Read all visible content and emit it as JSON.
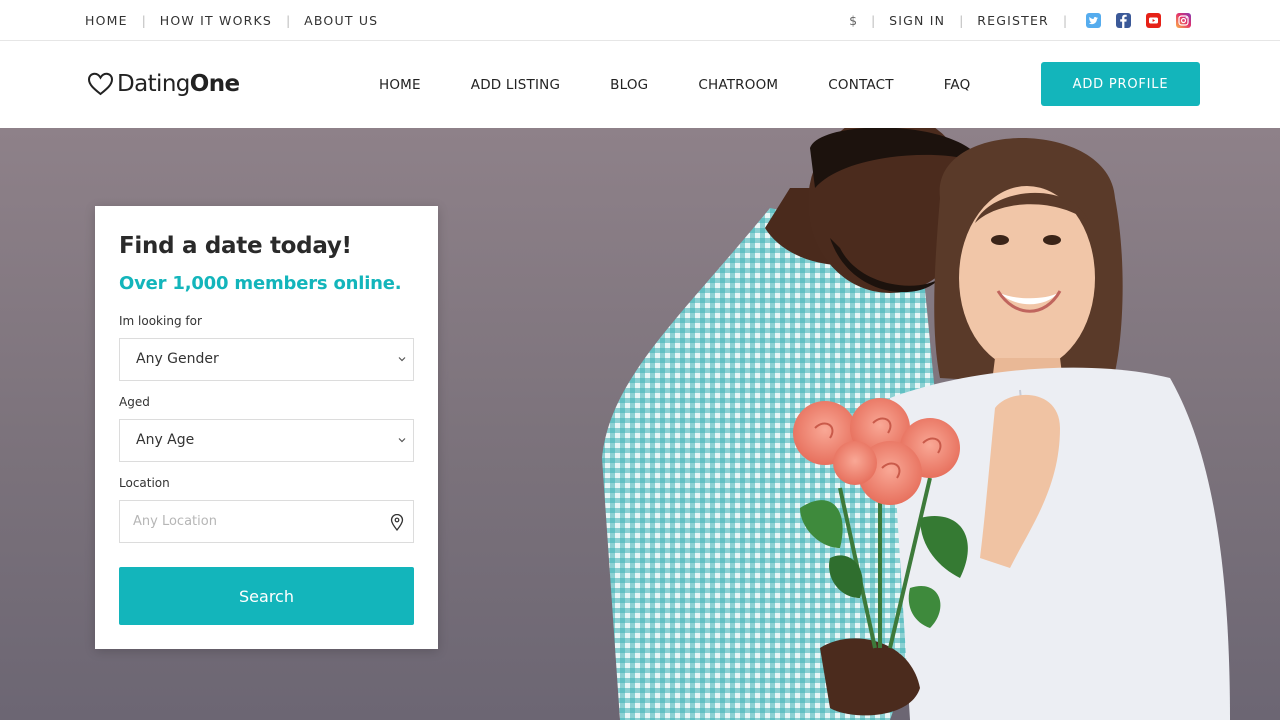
{
  "topbar": {
    "left_links": [
      "HOME",
      "HOW IT WORKS",
      "ABOUT US"
    ],
    "currency": "$",
    "sign_in": "SIGN IN",
    "register": "REGISTER",
    "social": [
      "twitter-icon",
      "facebook-icon",
      "youtube-icon",
      "instagram-icon"
    ]
  },
  "nav": {
    "logo_prefix": "Dating",
    "logo_bold": "One",
    "items": [
      "HOME",
      "ADD LISTING",
      "BLOG",
      "CHATROOM",
      "CONTACT",
      "FAQ"
    ],
    "cta": "ADD PROFILE"
  },
  "search_card": {
    "title": "Find a date today!",
    "subtitle": "Over 1,000 members online.",
    "looking_for_label": "Im looking for",
    "gender_value": "Any Gender",
    "aged_label": "Aged",
    "age_value": "Any Age",
    "location_label": "Location",
    "location_placeholder": "Any Location",
    "search_button": "Search"
  },
  "colors": {
    "accent": "#13b5bb",
    "hero_bg": "#857b83",
    "twitter": "#55acee",
    "facebook": "#3b5998",
    "youtube": "#e62117",
    "instagram": "#d6249f"
  }
}
